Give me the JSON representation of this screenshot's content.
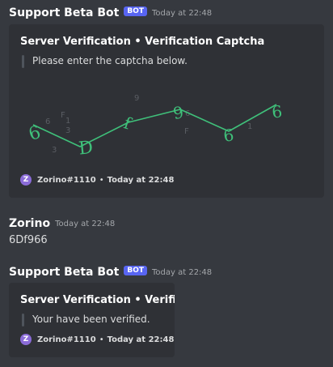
{
  "messages": [
    {
      "author": "Support Beta Bot",
      "tag": "BOT",
      "time": "Today at 22:48",
      "embed": {
        "title": "Server Verification • Verification Captcha",
        "description": "Please enter the captcha below.",
        "captcha_text": "6Df966",
        "captcha_noise": [
          "6",
          "F",
          "1",
          "3",
          "3",
          "9",
          "F",
          "6",
          "1"
        ],
        "footer_user": "Zorino#1110",
        "footer_time": "Today at 22:48",
        "footer_avatar": "Z"
      }
    },
    {
      "author": "Zorino",
      "time": "Today at 22:48",
      "content": "6Df966"
    },
    {
      "author": "Support Beta Bot",
      "tag": "BOT",
      "time": "Today at 22:48",
      "embed": {
        "title": "Server Verification • Verified",
        "description": "Your have been verified.",
        "footer_user": "Zorino#1110",
        "footer_time": "Today at 22:48",
        "footer_avatar": "Z"
      }
    }
  ],
  "footer_separator": "•",
  "colors": {
    "captcha_line": "#3fc07a",
    "captcha_noise": "#5a5d63",
    "bot_tag": "#5865f2",
    "footer_avatar": "#8b6cd8"
  }
}
